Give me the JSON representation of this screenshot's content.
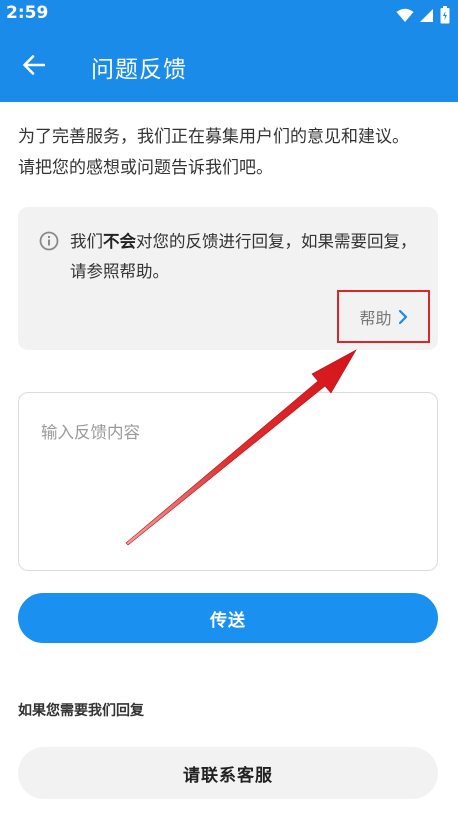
{
  "status_bar": {
    "time": "2:59",
    "icons": [
      "wifi-icon",
      "signal-icon",
      "battery-icon"
    ]
  },
  "app_bar": {
    "back_icon": "arrow-left-icon",
    "title": "问题反馈"
  },
  "intro": {
    "line1": "为了完善服务，我们正在募集用户们的意见和建议。",
    "line2": "请把您的感想或问题告诉我们吧。"
  },
  "notice": {
    "icon": "info-icon",
    "text_before": "我们",
    "text_bold": "不会",
    "text_after": "对您的反馈进行回复，如果需要回复，请参照帮助。",
    "help_label": "帮助",
    "help_icon": "chevron-right-icon"
  },
  "feedback": {
    "placeholder": "输入反馈内容",
    "value": ""
  },
  "send_label": "传送",
  "reply_heading": "如果您需要我们回复",
  "contact_label": "请联系客服",
  "colors": {
    "primary": "#1a8be8",
    "button": "#1a90f0",
    "annotation": "#d9262a",
    "link_chevron": "#1a8be8"
  }
}
